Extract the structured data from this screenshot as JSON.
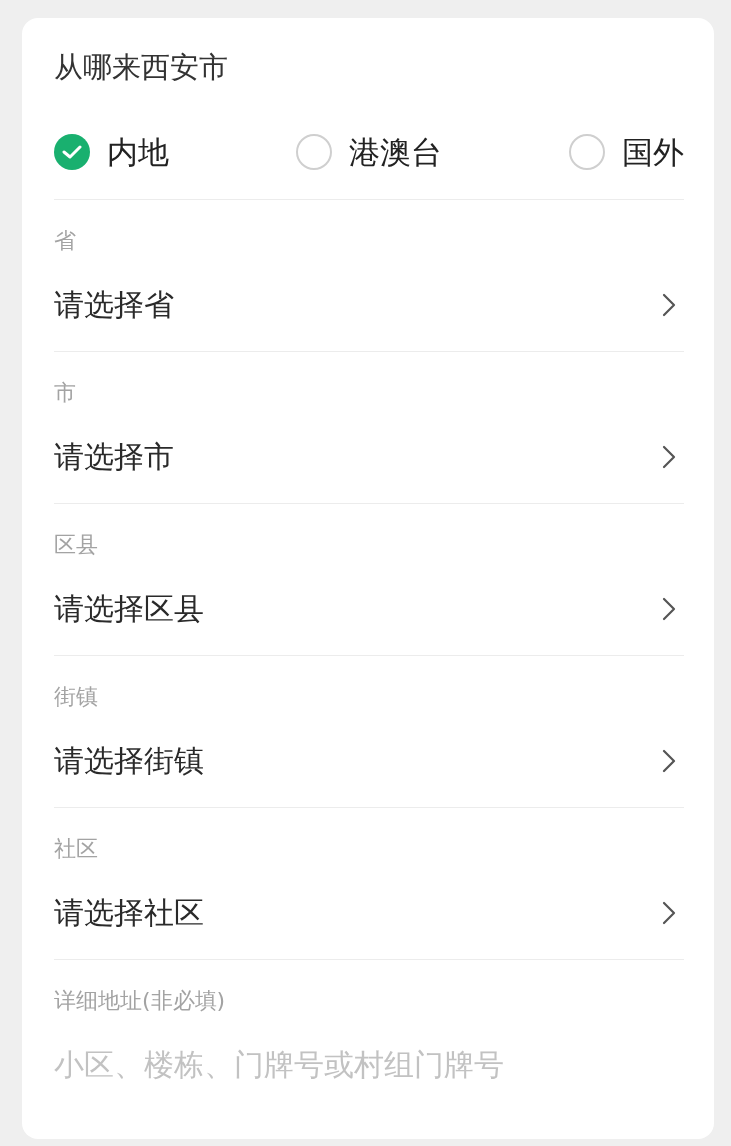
{
  "title": "从哪来西安市",
  "regions": [
    {
      "label": "内地",
      "selected": true
    },
    {
      "label": "港澳台",
      "selected": false
    },
    {
      "label": "国外",
      "selected": false
    }
  ],
  "fields": [
    {
      "kind": "select",
      "label": "省",
      "prompt": "请选择省"
    },
    {
      "kind": "select",
      "label": "市",
      "prompt": "请选择市"
    },
    {
      "kind": "select",
      "label": "区县",
      "prompt": "请选择区县"
    },
    {
      "kind": "select",
      "label": "街镇",
      "prompt": "请选择街镇"
    },
    {
      "kind": "select",
      "label": "社区",
      "prompt": "请选择社区"
    },
    {
      "kind": "input",
      "label": "详细地址(非必填)",
      "placeholder": "小区、楼栋、门牌号或村组门牌号"
    }
  ]
}
